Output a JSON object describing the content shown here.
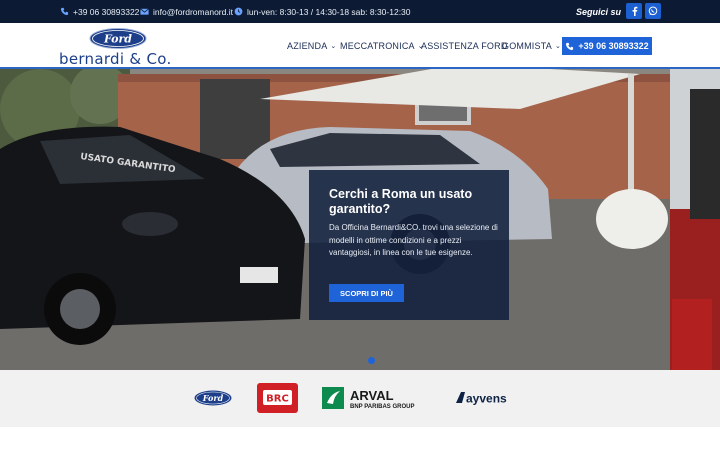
{
  "topbar": {
    "phone": "+39 06 30893322",
    "email": "info@fordromanord.it",
    "hours": "lun-ven: 8:30-13 / 14:30-18 sab: 8:30-12:30",
    "follow_label": "Seguici su",
    "social": [
      {
        "name": "facebook",
        "icon": "facebook-icon"
      },
      {
        "name": "whatsapp",
        "icon": "whatsapp-icon"
      }
    ]
  },
  "header": {
    "logo_badge": "Ford",
    "logo_text": "bernardi & Co.",
    "nav": [
      {
        "label": "AZIENDA",
        "dropdown": true
      },
      {
        "label": "MECCATRONICA",
        "dropdown": true
      },
      {
        "label": "ASSISTENZA FORD",
        "dropdown": false
      },
      {
        "label": "GOMMISTA",
        "dropdown": true
      }
    ],
    "call_button": "+39 06 30893322"
  },
  "hero": {
    "title": "Cerchi a Roma un usato garantito?",
    "body": "Da Officina Bernardi&CO. trovi una selezione di modelli in ottime condizioni e a prezzi vantaggiosi, in linea con le tue esigenze.",
    "button": "SCOPRI DI PIÙ",
    "windshield_text": "USATO GARANTITO",
    "slides_active": 1
  },
  "brands": {
    "items": [
      {
        "name": "Ford",
        "text": "Ford"
      },
      {
        "name": "BRC",
        "text": "BRC"
      },
      {
        "name": "Arval",
        "text": "ARVAL",
        "subtext": "BNP PARIBAS GROUP"
      },
      {
        "name": "Ayvens",
        "text": "ayvens"
      }
    ]
  },
  "colors": {
    "topbar_bg": "#0c1b33",
    "accent": "#1e63d8",
    "nav_text": "#1a2d55",
    "brands_bg": "#f1f1f1"
  }
}
